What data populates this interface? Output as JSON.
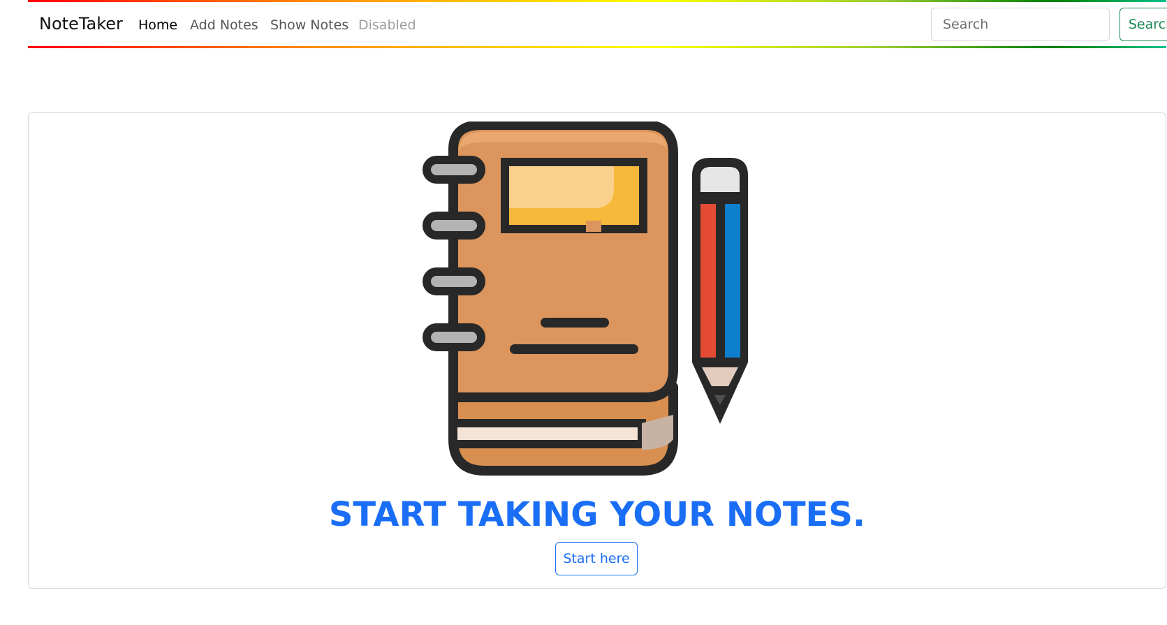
{
  "navbar": {
    "brand": "NoteTaker",
    "links": [
      {
        "label": "Home",
        "state": "active"
      },
      {
        "label": "Add Notes",
        "state": "normal"
      },
      {
        "label": "Show Notes",
        "state": "normal"
      },
      {
        "label": "Disabled",
        "state": "disabled"
      }
    ],
    "search": {
      "placeholder": "Search",
      "value": "",
      "button_label": "Search"
    }
  },
  "hero": {
    "illustration_icons": [
      "notebook-icon",
      "pencil-icon"
    ],
    "headline": "START TAKING YOUR NOTES.",
    "cta_label": "Start here"
  },
  "colors": {
    "brand_blue": "#1a6ef5",
    "success_green": "#198754",
    "notebook_cover": "#dc955c",
    "label_yellow": "#f7b93b",
    "pencil_red": "#e34b35",
    "pencil_blue": "#0e7fcc"
  }
}
